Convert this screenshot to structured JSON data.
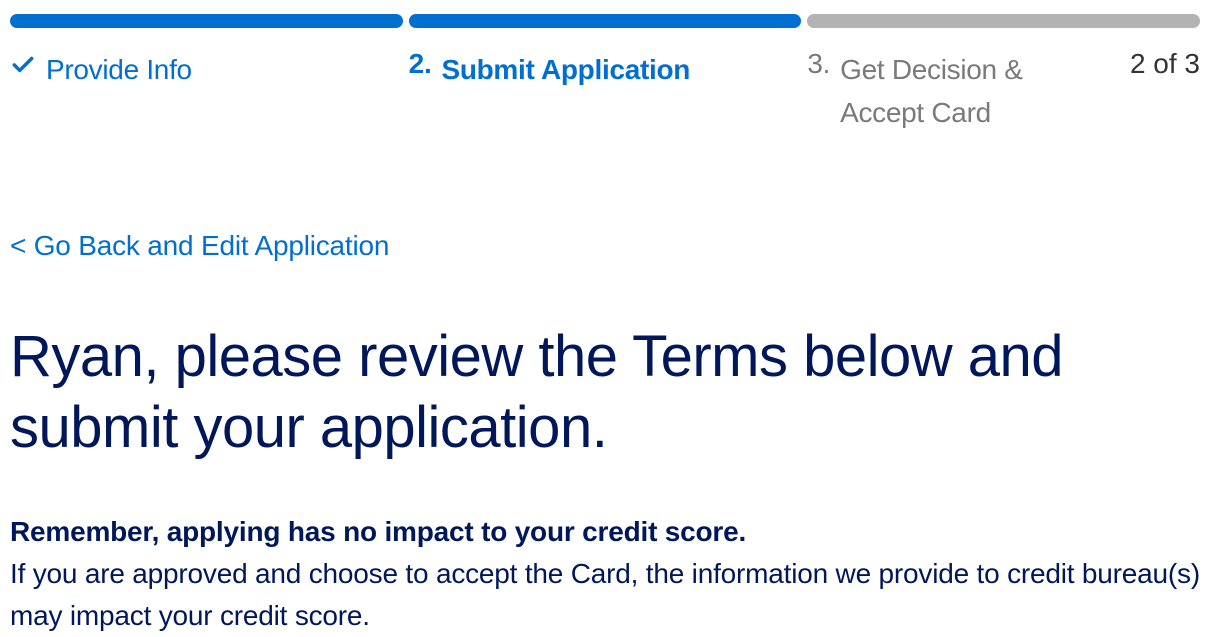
{
  "progress": {
    "steps": [
      {
        "label": "Provide Info",
        "done": true
      },
      {
        "number": "2.",
        "label": "Submit Application",
        "current": true
      },
      {
        "number": "3.",
        "label": "Get Decision & Accept Card"
      }
    ],
    "counter": "2 of 3"
  },
  "go_back_label": "< Go Back and Edit Application",
  "heading": "Ryan, please review the Terms below and submit your application.",
  "reminder_bold": "Remember, applying has no impact to your credit score.",
  "reminder_body": "If you are approved and choose to accept the Card, the information we provide to credit bureau(s) may impact your credit score."
}
